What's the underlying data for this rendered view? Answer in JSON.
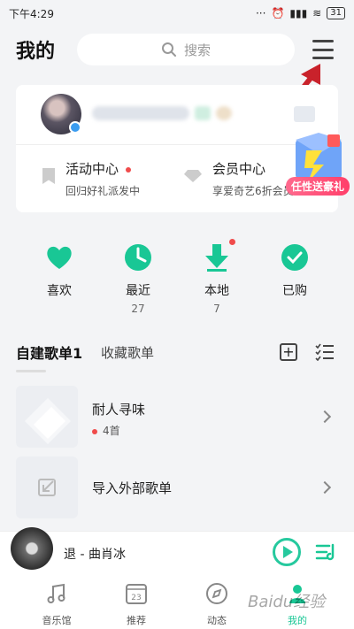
{
  "status_bar": {
    "time": "下午4:29",
    "battery": "31"
  },
  "header": {
    "title": "我的",
    "search_placeholder": "搜索"
  },
  "promo": {
    "label": "任性送豪礼"
  },
  "card": {
    "activity": {
      "title": "活动中心",
      "subtitle": "回归好礼派发中"
    },
    "vip": {
      "title": "会员中心",
      "subtitle": "享爱奇艺6折会员"
    }
  },
  "quick": [
    {
      "label": "喜欢",
      "count": "",
      "icon": "heart-icon"
    },
    {
      "label": "最近",
      "count": "27",
      "icon": "clock-icon"
    },
    {
      "label": "本地",
      "count": "7",
      "icon": "download-icon"
    },
    {
      "label": "已购",
      "count": "",
      "icon": "check-icon"
    }
  ],
  "tabs": {
    "active": "自建歌单1",
    "other": "收藏歌单"
  },
  "playlists": [
    {
      "title": "耐人寻味",
      "subtitle": "4首"
    },
    {
      "title": "导入外部歌单",
      "subtitle": ""
    }
  ],
  "player": {
    "song": "退 - 曲肖冰"
  },
  "nav": [
    {
      "label": "音乐馆",
      "icon": "music-note-icon"
    },
    {
      "label": "推荐",
      "icon": "calendar-icon",
      "badge": "23"
    },
    {
      "label": "动态",
      "icon": "compass-icon"
    },
    {
      "label": "我的",
      "icon": "profile-icon"
    }
  ],
  "watermark": "Baidu经验",
  "colors": {
    "accent": "#19c795",
    "red": "#f04b4b",
    "arrow": "#c9222b"
  }
}
